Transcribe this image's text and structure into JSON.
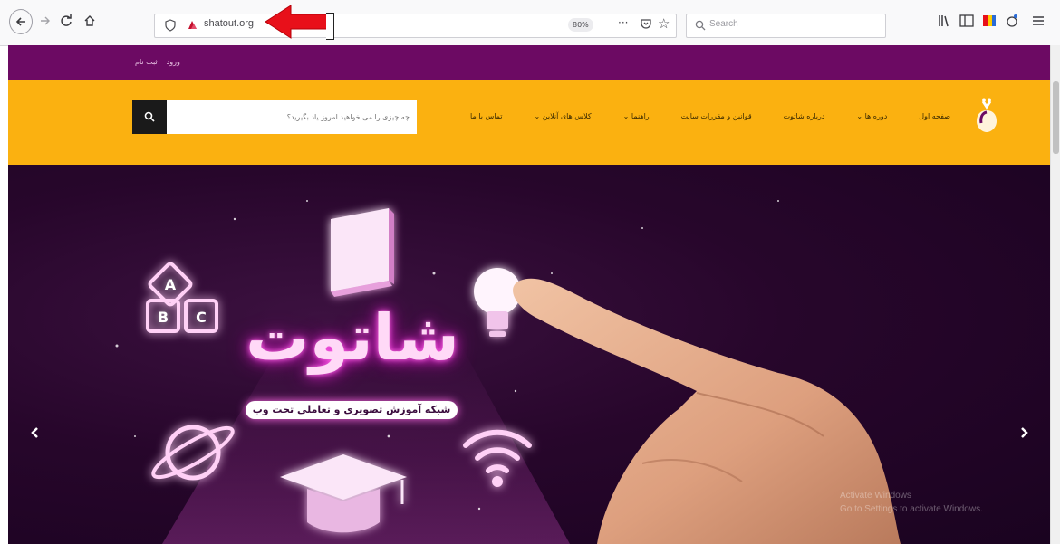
{
  "browser": {
    "url": "shatout.org",
    "zoom": "80%",
    "search_placeholder": "Search"
  },
  "site": {
    "topbar_links": [
      "ثبت نام",
      "ورود"
    ],
    "search_placeholder": "چه چیزی را می خواهید امروز یاد بگیرید؟",
    "nav": [
      "صفحه اول",
      "دوره ها",
      "درباره شاتوت",
      "قوانین و مقررات سایت",
      "راهنما",
      "کلاس های آنلاین",
      "تماس با ما"
    ],
    "nav_dropdown_marker": "⌄"
  },
  "hero": {
    "brand": "شاتوت",
    "tagline": "شبکه آموزش تصویری و تعاملی تحت وب",
    "block_letters": [
      "A",
      "B",
      "C"
    ],
    "watermark_line1": "Activate Windows",
    "watermark_line2": "Go to Settings to activate Windows."
  },
  "colors": {
    "site_purple": "#6c0a63",
    "header_yellow": "#fbb110",
    "hero_background": "#27062b",
    "neon_pink": "#e02bd0",
    "annotation_red": "#e8101a"
  }
}
